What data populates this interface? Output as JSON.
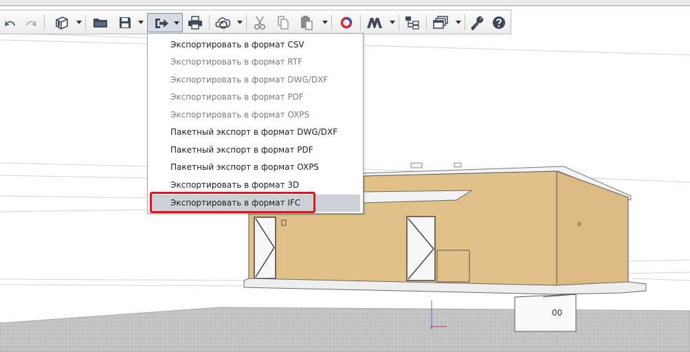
{
  "toolbar": {
    "buttons": [
      {
        "name": "undo-button",
        "icon": "undo-icon"
      },
      {
        "name": "redo-button",
        "icon": "redo-icon"
      },
      {
        "name": "3d-view-button",
        "icon": "cube-icon"
      },
      {
        "name": "open-button",
        "icon": "folder-icon"
      },
      {
        "name": "save-button",
        "icon": "floppy-disk-icon"
      },
      {
        "name": "export-button",
        "icon": "export-arrow-icon"
      },
      {
        "name": "print-button",
        "icon": "printer-icon"
      },
      {
        "name": "sync-button",
        "icon": "cloud-sync-icon"
      },
      {
        "name": "cut-button",
        "icon": "scissors-icon"
      },
      {
        "name": "copy-button",
        "icon": "copy-icon"
      },
      {
        "name": "paste-button",
        "icon": "clipboard-icon"
      },
      {
        "name": "addon-button",
        "icon": "ring-logo-icon"
      },
      {
        "name": "brand-button",
        "icon": "m-logo-icon"
      },
      {
        "name": "hierarchy-button",
        "icon": "hierarchy-icon"
      },
      {
        "name": "windows-button",
        "icon": "windows-stack-icon"
      },
      {
        "name": "settings-button",
        "icon": "wrench-icon"
      },
      {
        "name": "help-button",
        "icon": "help-circle-icon"
      }
    ]
  },
  "export_menu": {
    "items": [
      {
        "label": "Экспортировать в формат CSV",
        "enabled": true
      },
      {
        "label": "Экспортировать в формат RTF",
        "enabled": false
      },
      {
        "label": "Экспортировать в формат DWG/DXF",
        "enabled": false
      },
      {
        "label": "Экспортировать в формат PDF",
        "enabled": false
      },
      {
        "label": "Экспортировать в формат OXPS",
        "enabled": false
      },
      {
        "label": "Пакетный экспорт в формат DWG/DXF",
        "enabled": true
      },
      {
        "label": "Пакетный экспорт в формат PDF",
        "enabled": true
      },
      {
        "label": "Пакетный экспорт в формат OXPS",
        "enabled": true
      },
      {
        "label": "Экспортировать в формат 3D",
        "enabled": true
      },
      {
        "label": "Экспортировать в формат IFC",
        "enabled": true,
        "hovered": true
      }
    ]
  },
  "viewport": {
    "block_label": "00",
    "wall_color": "#e2c189",
    "highlight_color": "#e0141b"
  }
}
